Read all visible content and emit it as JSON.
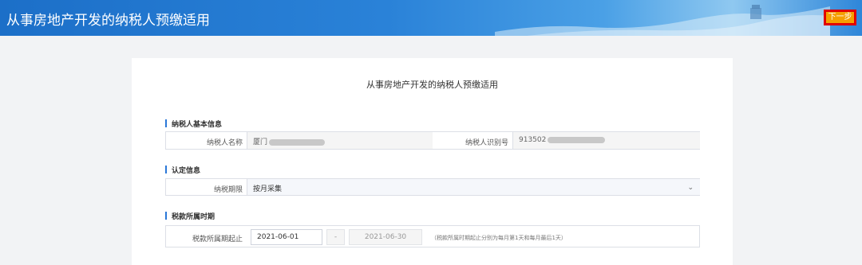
{
  "header": {
    "title": "从事房地产开发的纳税人预缴适用",
    "next_label": "下一步"
  },
  "form": {
    "title": "从事房地产开发的纳税人预缴适用",
    "section_basic": "纳税人基本信息",
    "taxpayer_name_label": "纳税人名称",
    "taxpayer_name_value": "厦门",
    "taxpayer_id_label": "纳税人识别号",
    "taxpayer_id_value": "913502",
    "section_cert": "认定信息",
    "tax_period_label": "纳税期限",
    "tax_period_value": "按月采集",
    "section_period": "税款所属时期",
    "period_label": "税款所属期起止",
    "period_start": "2021-06-01",
    "period_sep": "-",
    "period_end": "2021-06-30",
    "period_hint": "（税款所属时期起止分别为每月第1天和每月最后1天）"
  },
  "colors": {
    "accent": "#2b78d8",
    "next_button": "#f5a000",
    "next_border": "#e00000"
  }
}
